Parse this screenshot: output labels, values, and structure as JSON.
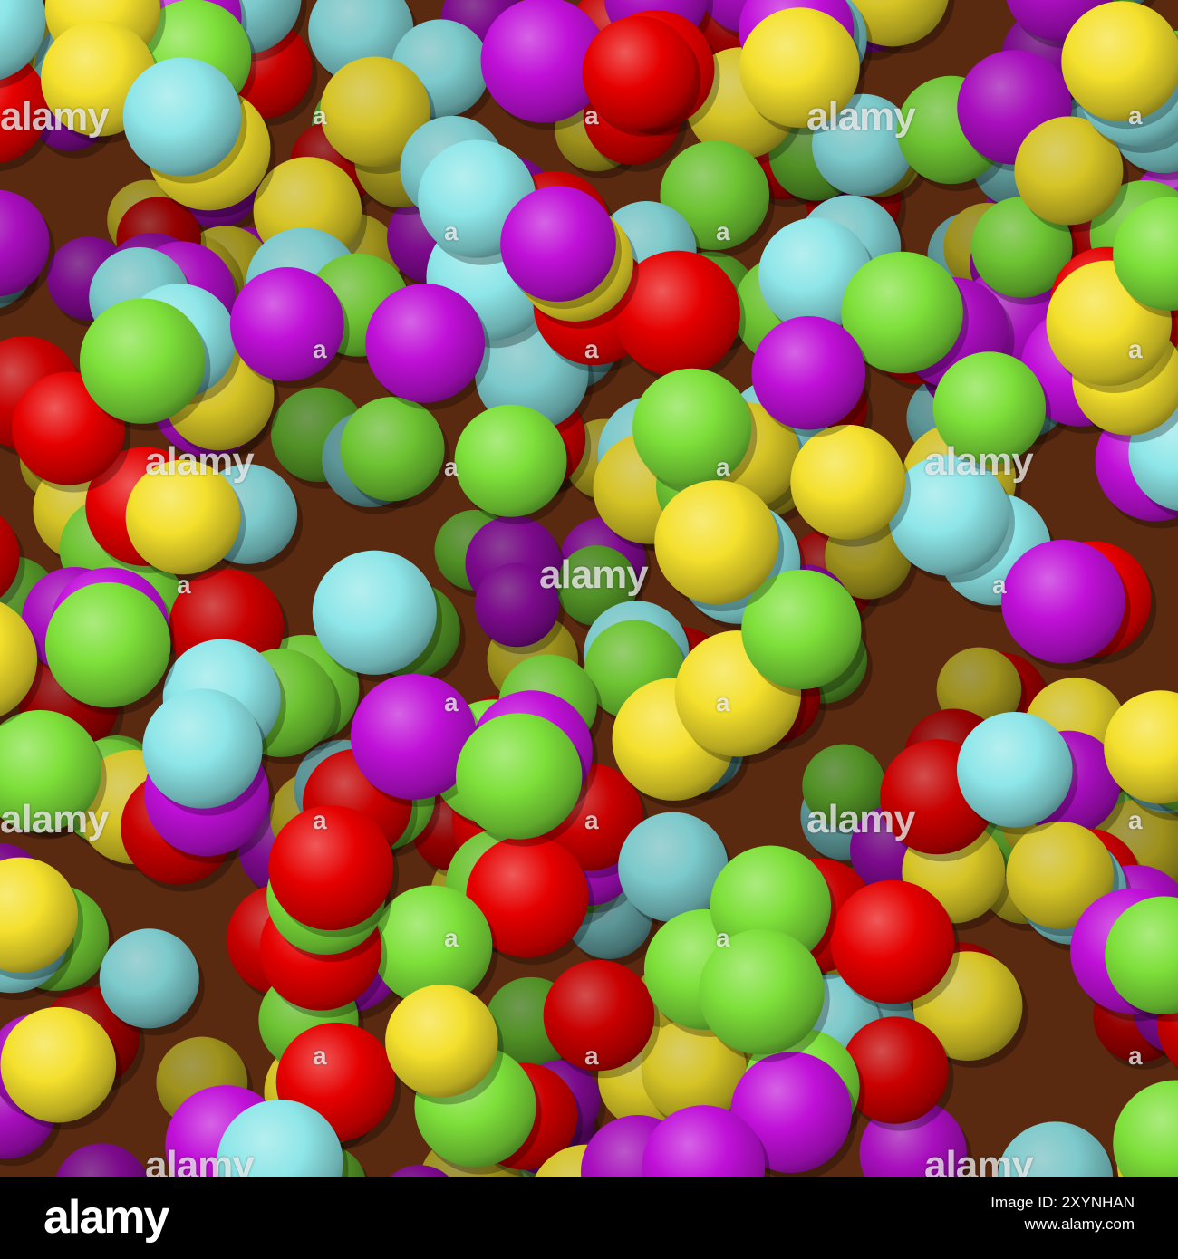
{
  "photo": {
    "colors": {
      "red": "#e60000",
      "magenta": "#c010d8",
      "green": "#7ee03a",
      "cyan": "#8ee6e8",
      "yellow": "#f4e02c"
    },
    "watermark": "alamy",
    "watermark_small": "a"
  },
  "footer": {
    "logo": "alamy",
    "image_id_line": "Image ID: 2XYNHAN",
    "site": "www.alamy.com"
  }
}
